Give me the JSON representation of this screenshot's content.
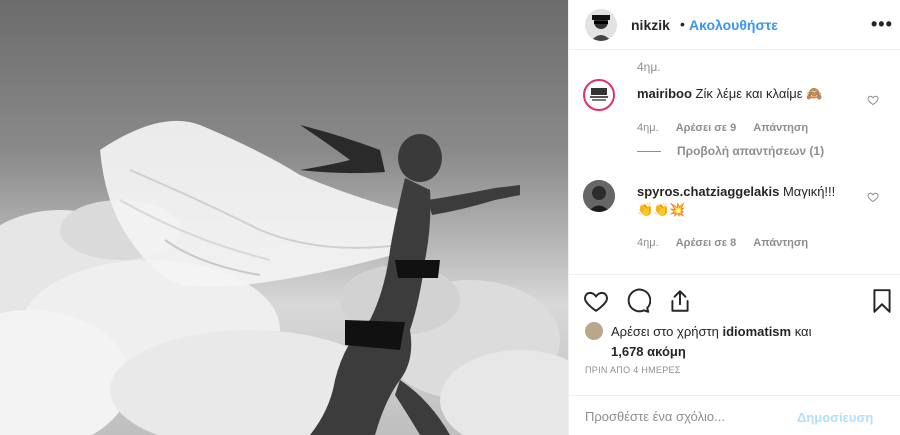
{
  "post": {
    "username": "nikzik",
    "separator": "•",
    "follow_label": "Ακολουθήστε",
    "more_label": "•••"
  },
  "comments": {
    "top_time": "4ημ.",
    "items": [
      {
        "username": "mairiboo",
        "text": "Ζίκ λέμε και κλαίμε 🙈",
        "time": "4ημ.",
        "likes": "Αρέσει σε 9",
        "reply": "Απάντηση",
        "view_replies": "Προβολή απαντήσεων (1)"
      },
      {
        "username": "spyros.chatziaggelakis",
        "text": "Μαγική!!!",
        "emoji": "👏👏💥",
        "time": "4ημ.",
        "likes": "Αρέσει σε 8",
        "reply": "Απάντηση"
      }
    ]
  },
  "likes": {
    "prefix": "Αρέσει στο χρήστη",
    "user": "idiomatism",
    "joiner": "και",
    "others": "1,678 ακόμη"
  },
  "date": "ΠΡΙΝ ΑΠΟ 4 ΗΜΕΡΕΣ",
  "add_comment": {
    "placeholder": "Προσθέστε ένα σχόλιο...",
    "post_label": "Δημοσίευση"
  },
  "icons": {
    "like": "heart-icon",
    "comment": "comment-icon",
    "share": "share-icon",
    "save": "bookmark-icon",
    "more": "more-options-icon"
  },
  "colors": {
    "accent": "#3897f0",
    "text": "#262626",
    "muted": "#8e8e8e",
    "post_disabled": "#b2dffc",
    "story_ring": "#e1306c"
  }
}
